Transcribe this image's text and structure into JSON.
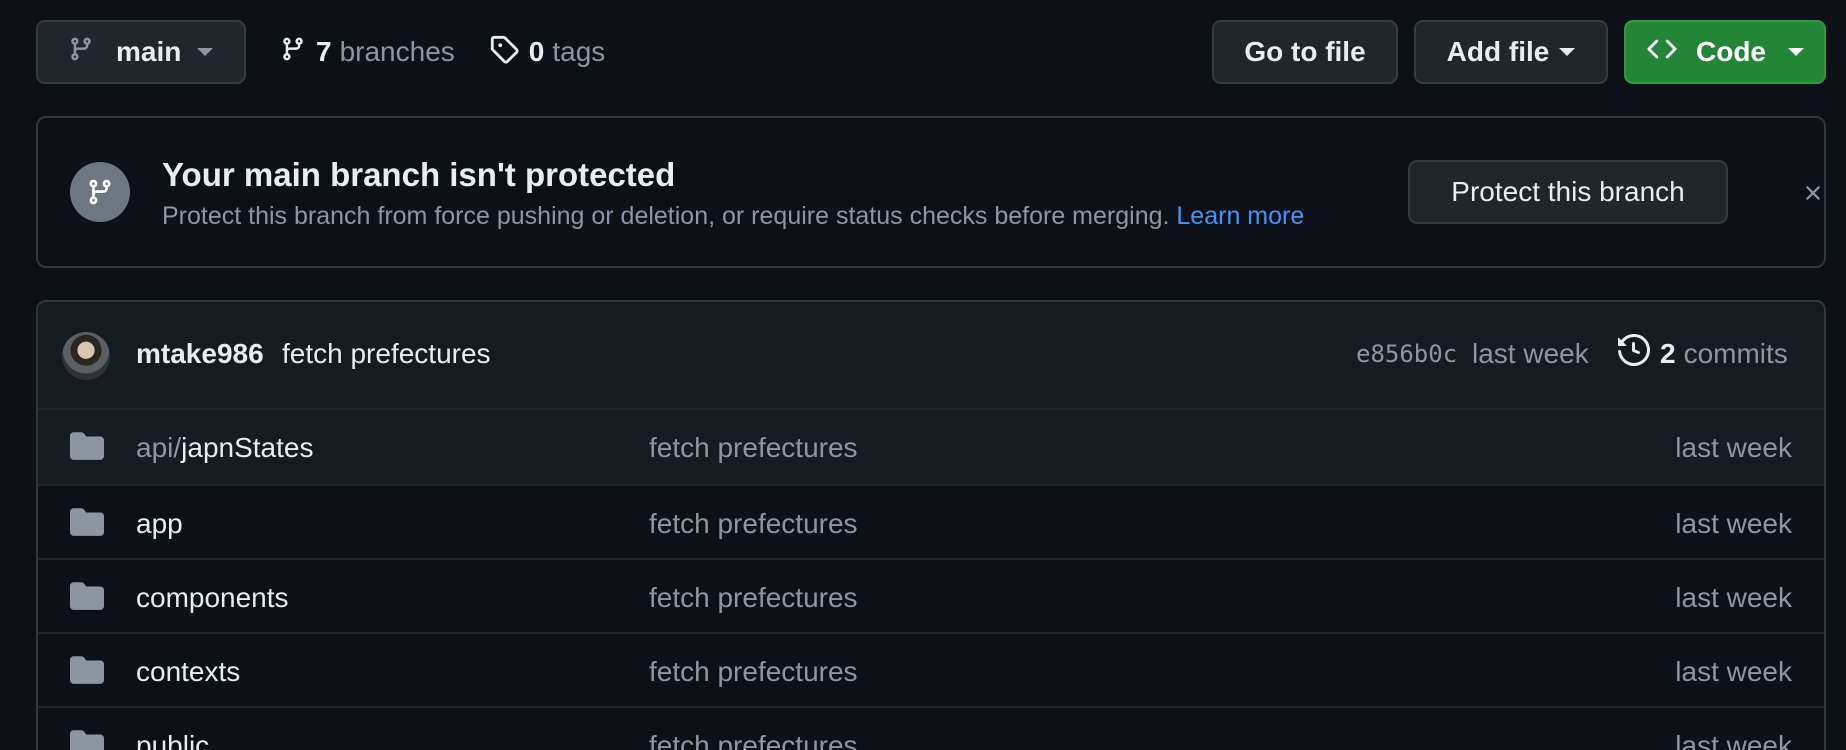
{
  "toolbar": {
    "branch": {
      "label": "main",
      "icon": "git-branch-icon"
    },
    "branches": {
      "count": "7",
      "label": "branches",
      "icon": "git-branch-icon"
    },
    "tags": {
      "count": "0",
      "label": "tags",
      "icon": "tag-icon"
    },
    "go_to_file_label": "Go to file",
    "add_file_label": "Add file",
    "code_label": "Code"
  },
  "banner": {
    "icon": "git-branch-icon",
    "title": "Your main branch isn't protected",
    "description": "Protect this branch from force pushing or deletion, or require status checks before merging.",
    "learn_more_label": "Learn more",
    "protect_label": "Protect this branch",
    "dismiss_icon": "close-icon"
  },
  "latest_commit": {
    "author": "mtake986",
    "message": "fetch prefectures",
    "sha": "e856b0c",
    "time": "last week",
    "commits_count": "2",
    "commits_label": "commits",
    "history_icon": "history-icon"
  },
  "files": [
    {
      "prefix": "api/",
      "name": "japnStates",
      "message": "fetch prefectures",
      "time": "last week",
      "type": "directory"
    },
    {
      "prefix": "",
      "name": "app",
      "message": "fetch prefectures",
      "time": "last week",
      "type": "directory"
    },
    {
      "prefix": "",
      "name": "components",
      "message": "fetch prefectures",
      "time": "last week",
      "type": "directory"
    },
    {
      "prefix": "",
      "name": "contexts",
      "message": "fetch prefectures",
      "time": "last week",
      "type": "directory"
    },
    {
      "prefix": "",
      "name": "public",
      "message": "fetch prefectures",
      "time": "last week",
      "type": "directory"
    }
  ],
  "colors": {
    "background": "#0d1117",
    "accent_green": "#238636",
    "link_blue": "#4493f8",
    "muted_text": "#8d96a0"
  }
}
